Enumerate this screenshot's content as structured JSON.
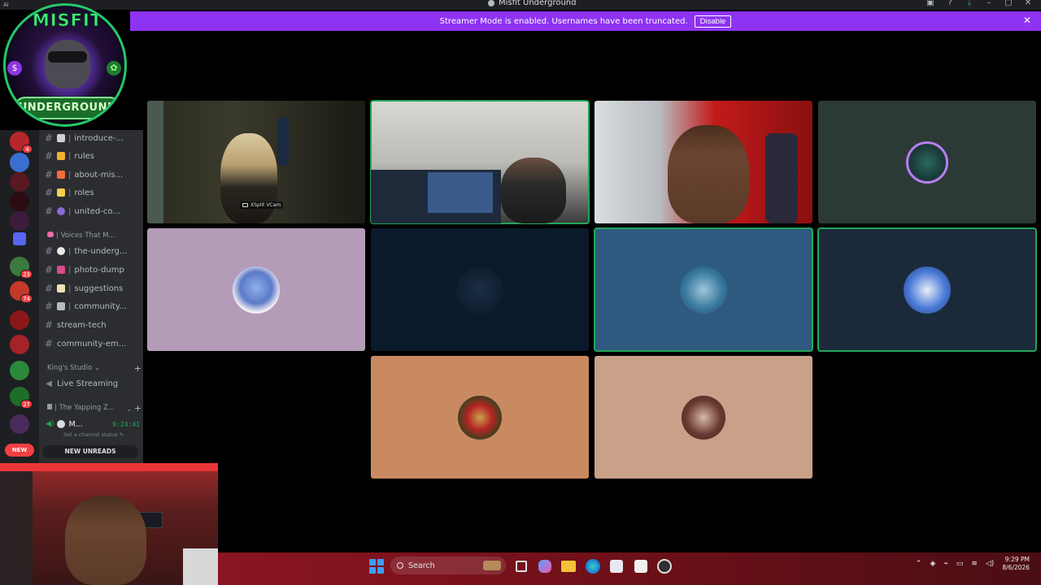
{
  "window": {
    "title": "Misfit Underground",
    "corner_label": "Ai"
  },
  "banner": {
    "message": "Streamer Mode is enabled. Usernames have been truncated.",
    "disable_label": "Disable",
    "close_glyph": "✕"
  },
  "logo": {
    "top_text": "MISFIT",
    "bottom_text": "UNDERGROUND",
    "dollar_glyph": "$",
    "leaf_glyph": "✿"
  },
  "server_rail": {
    "badges": [
      "4",
      "23",
      "74",
      "27"
    ],
    "new_label": "NEW"
  },
  "channels": {
    "items": [
      {
        "name": "introduce-...",
        "emoji_color": "#cfcfcf"
      },
      {
        "name": "rules",
        "emoji_color": "#f0b232"
      },
      {
        "name": "about-mis...",
        "emoji_color": "#f26c3a"
      },
      {
        "name": "roles",
        "emoji_color": "#f5d04c"
      },
      {
        "name": "united-co...",
        "emoji_color": "#8b6ad8"
      }
    ],
    "category_voices": "| Voices That M...",
    "items2": [
      {
        "name": "the-underg...",
        "emoji_color": "#e9e9e9"
      },
      {
        "name": "photo-dump",
        "emoji_color": "#d94a8c"
      },
      {
        "name": "suggestions",
        "emoji_color": "#f0e1b8"
      },
      {
        "name": "community...",
        "emoji_color": "#b5bac1"
      },
      {
        "name": "stream-tech",
        "emoji_color": null
      },
      {
        "name": "community-em...",
        "emoji_color": null
      }
    ],
    "category_kings": "King's Studio",
    "live_streaming": "Live Streaming",
    "category_yapping": "| The Yapping Z...",
    "voice_user": "M...",
    "voice_timer": "9:24:41",
    "status_hint": "Set a channel status",
    "new_unreads": "NEW UNREADS",
    "separator": "|",
    "plus": "+",
    "chevron": "⌄"
  },
  "tiles": {
    "cam_label": "XSplit VCam"
  },
  "taskbar": {
    "search_label": "Search",
    "time": "9:29 PM",
    "date": "8/6/2026"
  },
  "colors": {
    "accent": "#8e33f2",
    "speaking": "#23a55a",
    "tile_lavender": "#b49bb8",
    "tile_navy": "#0b1a2b",
    "tile_blue": "#2f5a80",
    "tile_slate": "#1a2a3a",
    "tile_orange": "#c98a62",
    "tile_tan": "#c9a088",
    "tile_dark": "#2c3a37"
  }
}
